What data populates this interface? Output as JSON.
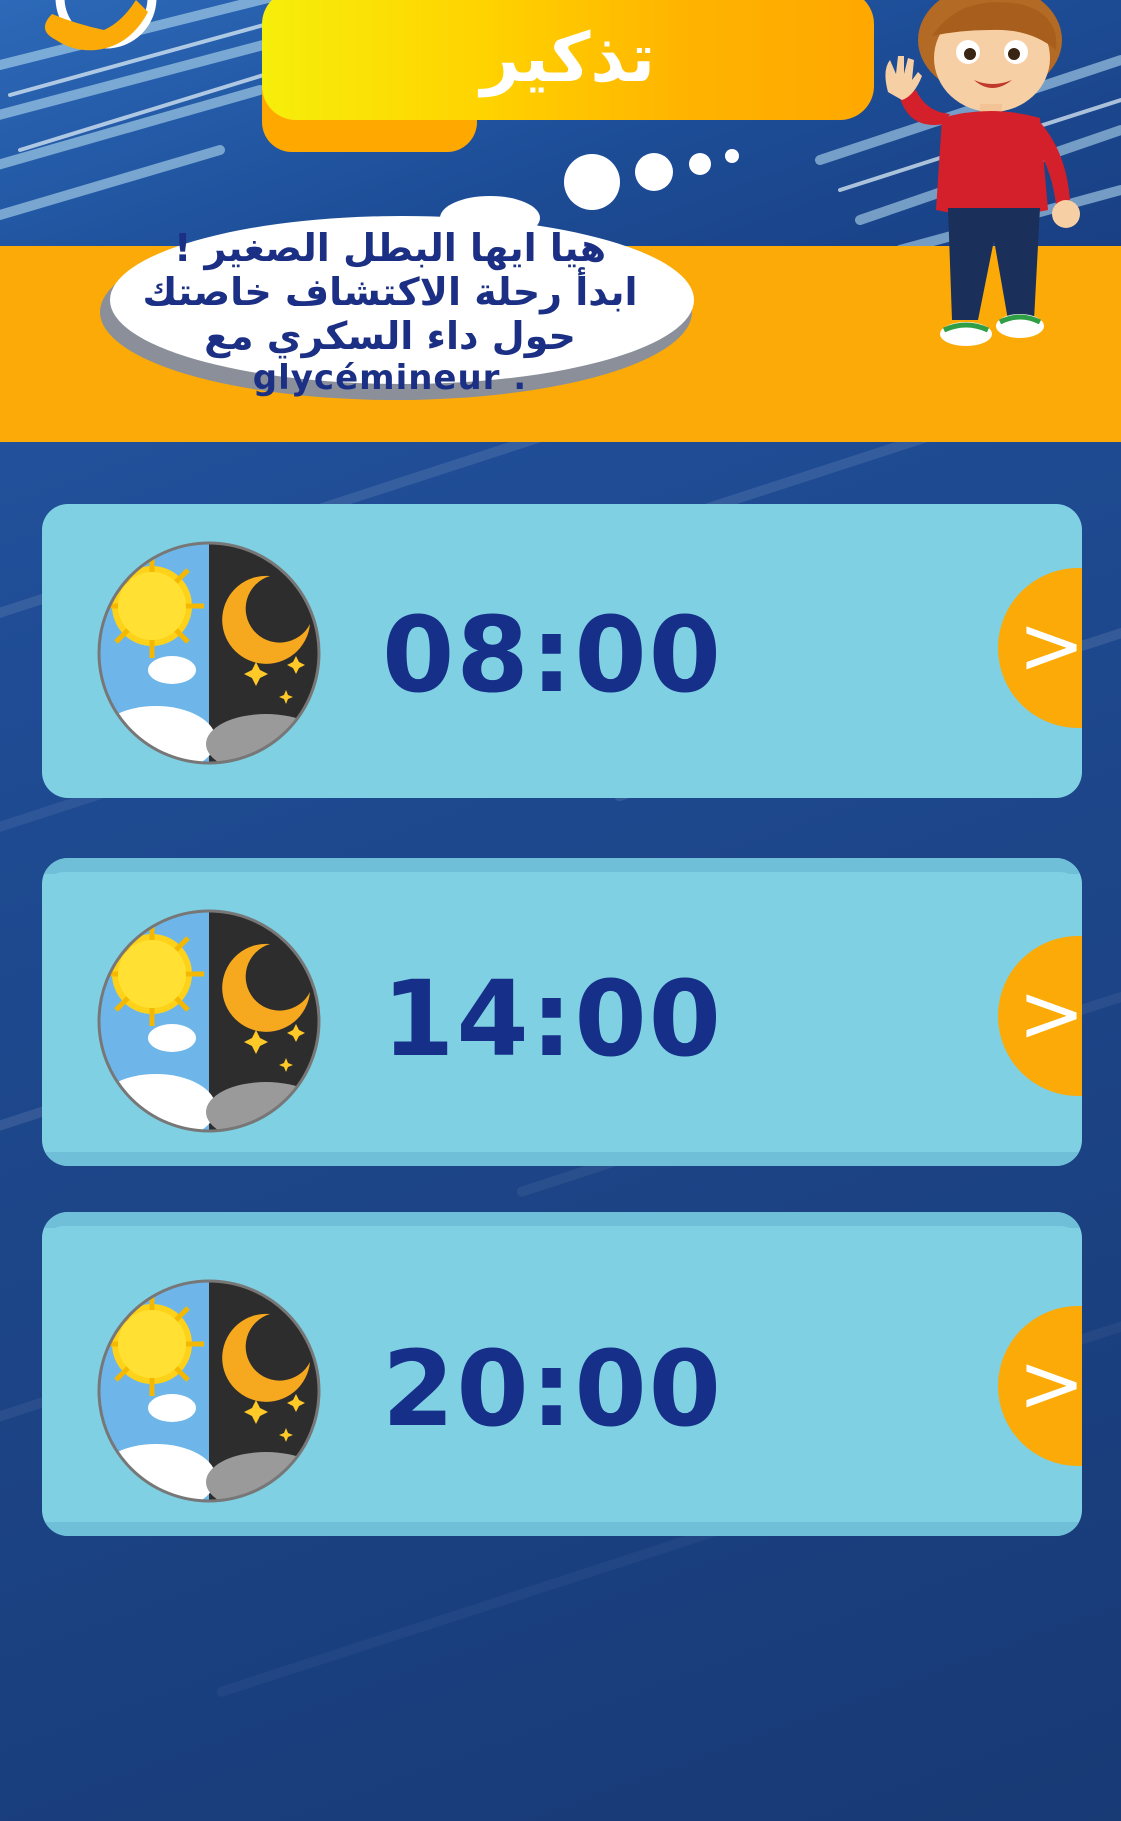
{
  "header": {
    "title": "تذكير",
    "bubble_lines": [
      "هيا ايها البطل الصغير !",
      "ابدأ رحلة الاكتشاف خاصتك",
      "حول داء السكري مع"
    ],
    "bubble_brand": "glycémineur ."
  },
  "reminders": [
    {
      "time": "08:00",
      "icon": "day-night-icon",
      "action": "chevron-right-icon"
    },
    {
      "time": "14:00",
      "icon": "day-night-icon",
      "action": "chevron-right-icon"
    },
    {
      "time": "20:00",
      "icon": "day-night-icon",
      "action": "chevron-right-icon"
    }
  ],
  "arrow_glyph": ">",
  "colors": {
    "accent_orange": "#fbaa07",
    "title_yellow": "#f6ee0b",
    "card_bg": "#80d0e3",
    "text_navy": "#16308a",
    "background_blue": "#1d4689"
  }
}
